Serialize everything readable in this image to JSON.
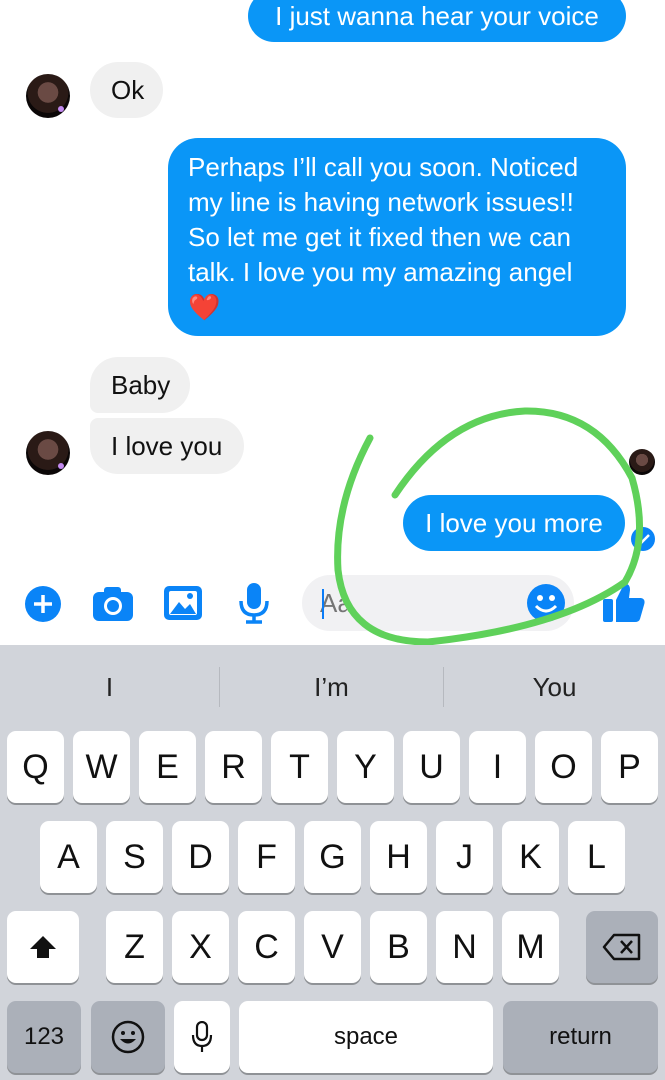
{
  "messages": {
    "out_top": "I just wanna hear your voice",
    "in_ok": "Ok",
    "out_long_lines": [
      "Perhaps I’ll call you soon. Noticed",
      "my line is having network issues!!",
      "So let me get it fixed then we can",
      "talk. I love you my amazing angel"
    ],
    "out_long_emoji": "❤️",
    "in_baby": "Baby",
    "in_love": "I love you",
    "out_more": "I love you more"
  },
  "composer": {
    "placeholder": "Aa"
  },
  "toolbar": {
    "icons": [
      "plus-icon",
      "camera-icon",
      "gallery-icon",
      "mic-icon",
      "emoji-icon",
      "thumbs-up-icon"
    ],
    "accent": "#0a84f7"
  },
  "annotation": {
    "color": "#5fd15a"
  },
  "keyboard": {
    "suggestions": [
      "I",
      "I’m",
      "You"
    ],
    "row1": [
      "Q",
      "W",
      "E",
      "R",
      "T",
      "Y",
      "U",
      "I",
      "O",
      "P"
    ],
    "row2": [
      "A",
      "S",
      "D",
      "F",
      "G",
      "H",
      "J",
      "K",
      "L"
    ],
    "row3": [
      "Z",
      "X",
      "C",
      "V",
      "B",
      "N",
      "M"
    ],
    "numbers_label": "123",
    "space_label": "space",
    "return_label": "return"
  }
}
